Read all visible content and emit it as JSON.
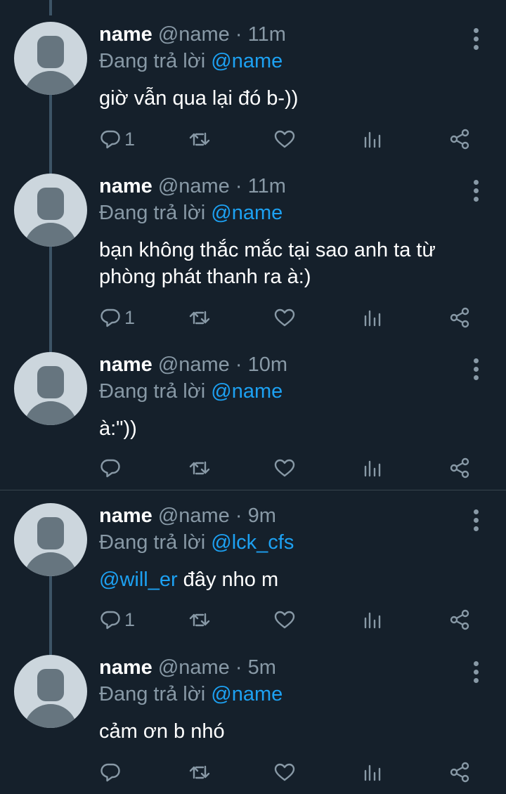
{
  "colors": {
    "background": "#15202b",
    "secondary_text": "#8899a6",
    "mention": "#1da1f2",
    "avatar_bg": "#ccd6dd",
    "avatar_fg": "#66757f",
    "thread_line": "#3d5466"
  },
  "reply_prefix": "Đang trả lời",
  "tweets": [
    {
      "name": "name",
      "handle": "@name",
      "sep": "·",
      "time": "11m",
      "reply_to": "@name",
      "text_lines": [
        "giờ vẫn qua lại đó b-))"
      ],
      "reply_count": "1"
    },
    {
      "name": "name",
      "handle": "@name",
      "sep": "·",
      "time": "11m",
      "reply_to": "@name",
      "text_lines": [
        "bạn không thắc mắc tại sao anh ta từ",
        "phòng phát thanh ra à:)"
      ],
      "reply_count": "1"
    },
    {
      "name": "name",
      "handle": "@name",
      "sep": "·",
      "time": "10m",
      "reply_to": "@name",
      "text_lines": [
        "à:\"))"
      ],
      "reply_count": ""
    },
    {
      "name": "name",
      "handle": "@name",
      "sep": "·",
      "time": "9m",
      "reply_to": "@lck_cfs",
      "text_mention": "@will_er",
      "text_rest": " đây nho m",
      "reply_count": "1"
    },
    {
      "name": "name",
      "handle": "@name",
      "sep": "·",
      "time": "5m",
      "reply_to": "@name",
      "text_lines": [
        "cảm ơn b nhó"
      ],
      "reply_count": ""
    }
  ],
  "icons": {
    "reply": "reply-icon",
    "retweet": "retweet-icon",
    "like": "heart-icon",
    "analytics": "analytics-icon",
    "share": "share-icon",
    "more": "more-vertical-icon"
  }
}
